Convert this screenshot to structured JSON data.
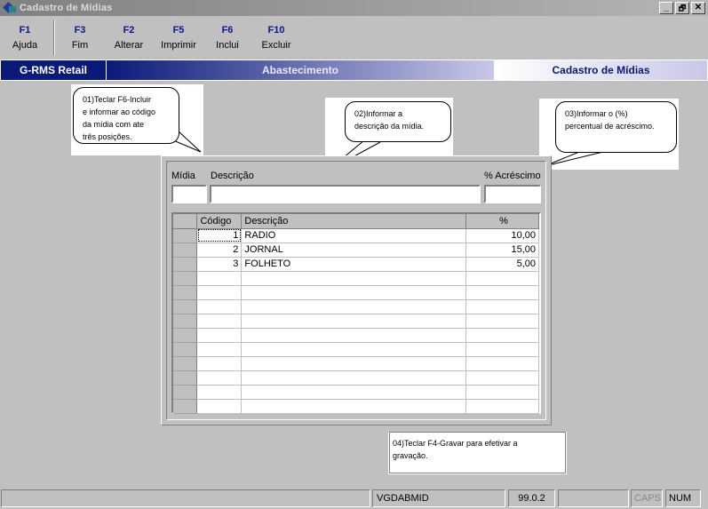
{
  "window": {
    "title": "Cadastro de Mídias",
    "buttons": [
      "_",
      "🗗",
      "✕"
    ]
  },
  "fkeys": [
    {
      "key": "F1",
      "label": "Ajuda"
    },
    {
      "key": "F3",
      "label": "Fim"
    },
    {
      "key": "F2",
      "label": "Alterar"
    },
    {
      "key": "F5",
      "label": "Imprimir"
    },
    {
      "key": "F6",
      "label": "Inclui"
    },
    {
      "key": "F10",
      "label": "Excluir"
    }
  ],
  "header": {
    "brand": "G-RMS Retail",
    "module": "Abastecimento",
    "screen": "Cadastro de Mídias"
  },
  "callouts": {
    "c1": [
      "01)Teclar F6-Incluir",
      "e informar ao código",
      "da mídia com ate",
      "três posições."
    ],
    "c2": [
      "02)Informar a",
      "descrição da mídia."
    ],
    "c3": [
      "03)Informar o (%)",
      "percentual de acréscimo."
    ],
    "c4": [
      "04)Teclar F4-Gravar para efetivar a",
      "gravação."
    ]
  },
  "form": {
    "midia_label": "Mídia",
    "descricao_label": "Descrição",
    "acrescimo_label": "% Acréscimo",
    "midia_value": "",
    "descricao_value": "",
    "acrescimo_value": ""
  },
  "grid": {
    "columns": [
      "Código",
      "Descrição",
      "%"
    ],
    "rows": [
      {
        "codigo": "1",
        "descricao": "RADIO",
        "pct": "10,00"
      },
      {
        "codigo": "2",
        "descricao": "JORNAL",
        "pct": "15,00"
      },
      {
        "codigo": "3",
        "descricao": "FOLHETO",
        "pct": "5,00"
      }
    ],
    "empty_rows": 10
  },
  "status": {
    "program": "VGDABMID",
    "version": "99.0.2",
    "caps": "CAPS",
    "num": "NUM"
  },
  "colors": {
    "navy": "#0a1a78",
    "fkey_blue": "#0a1a8a"
  }
}
